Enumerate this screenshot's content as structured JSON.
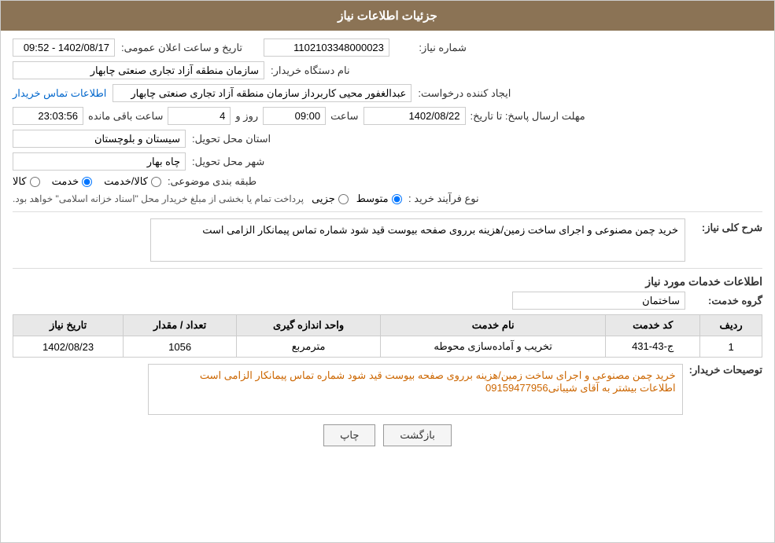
{
  "header": {
    "title": "جزئیات اطلاعات نیاز"
  },
  "fields": {
    "need_number_label": "شماره نیاز:",
    "need_number_value": "1102103348000023",
    "date_label": "تاریخ و ساعت اعلان عمومی:",
    "date_value": "1402/08/17 - 09:52",
    "org_label": "نام دستگاه خریدار:",
    "org_value": "سازمان منطقه آزاد تجاری صنعتی چابهار",
    "creator_label": "ایجاد کننده درخواست:",
    "creator_value": "عبدالغفور محیی کاربرداز سازمان منطقه آزاد تجاری صنعتی چابهار",
    "contact_link": "اطلاعات تماس خریدار",
    "deadline_label": "مهلت ارسال پاسخ: تا تاریخ:",
    "deadline_date": "1402/08/22",
    "deadline_time_label": "ساعت",
    "deadline_time": "09:00",
    "deadline_days_label": "روز و",
    "deadline_days": "4",
    "deadline_remaining_label": "ساعت باقی مانده",
    "deadline_remaining": "23:03:56",
    "province_label": "استان محل تحویل:",
    "province_value": "سیستان و بلوچستان",
    "city_label": "شهر محل تحویل:",
    "city_value": "چاه بهار",
    "category_label": "طبقه بندی موضوعی:",
    "category_options": [
      {
        "label": "کالا",
        "value": "kala"
      },
      {
        "label": "خدمت",
        "value": "khedmat",
        "checked": true
      },
      {
        "label": "کالا/خدمت",
        "value": "kala_khedmat"
      }
    ],
    "purchase_type_label": "نوع فرآیند خرید :",
    "purchase_type_options": [
      {
        "label": "جزیی",
        "value": "jozii"
      },
      {
        "label": "متوسط",
        "value": "motevaset",
        "checked": true
      }
    ],
    "purchase_type_note": "پرداخت تمام یا بخشی از مبلغ خریدار محل \"اسناد خزانه اسلامی\" خواهد بود.",
    "need_description_label": "شرح کلی نیاز:",
    "need_description_value": "خرید چمن مصنوعی و اجرای ساخت زمین/هزینه برروی صفحه بیوست قید شود شماره تماس پیمانکار الزامی است",
    "services_section_label": "اطلاعات خدمات مورد نیاز",
    "service_group_label": "گروه خدمت:",
    "service_group_value": "ساختمان",
    "table": {
      "headers": [
        "ردیف",
        "کد خدمت",
        "نام خدمت",
        "واحد اندازه گیری",
        "تعداد / مقدار",
        "تاریخ نیاز"
      ],
      "rows": [
        {
          "row": "1",
          "code": "ج-43-431",
          "name": "تخریب و آماده‌سازی محوطه",
          "unit": "مترمربع",
          "quantity": "1056",
          "date": "1402/08/23"
        }
      ]
    },
    "buyer_desc_label": "توصیحات خریدار:",
    "buyer_desc_value": "خرید چمن مصنوعی و اجرای ساخت زمین/هزینه برروی صفحه بیوست قید شود شماره تماس پیمانکار الزامی است\nاطلاعات بیشتر به آقای شیبانی09159477956"
  },
  "buttons": {
    "back_label": "بازگشت",
    "print_label": "چاپ"
  }
}
